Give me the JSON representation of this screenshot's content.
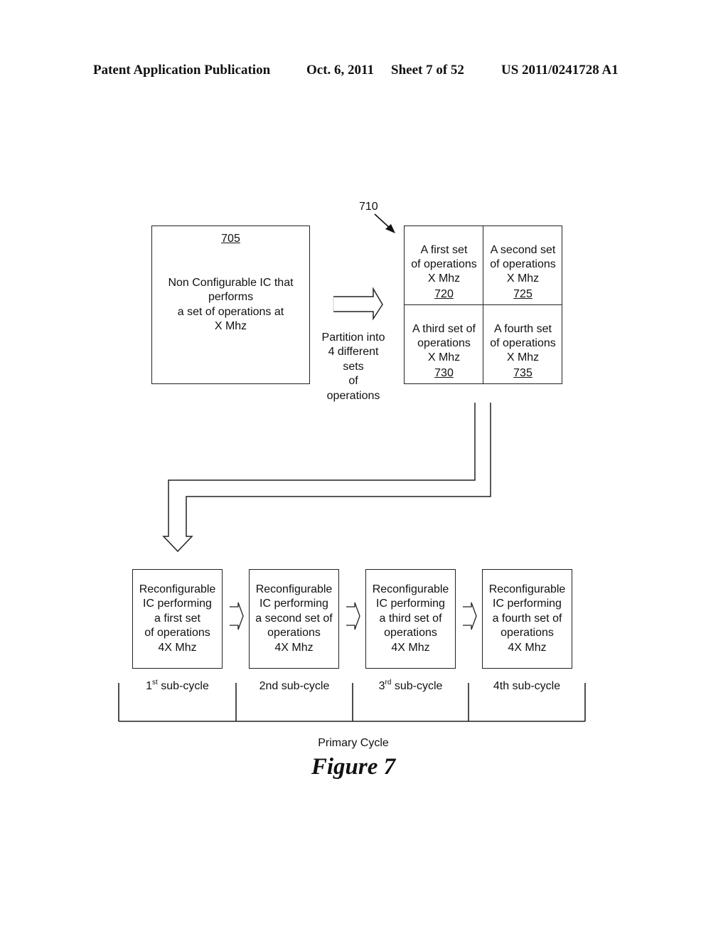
{
  "header": {
    "publication": "Patent Application Publication",
    "date": "Oct. 6, 2011",
    "sheet": "Sheet 7 of 52",
    "number": "US 2011/0241728 A1"
  },
  "block_705": {
    "ref": "705",
    "lines": [
      "Non Configurable IC that",
      "performs",
      "a set of operations at",
      "X Mhz"
    ]
  },
  "partition_arrow": {
    "lines": [
      "Partition into",
      "4 different",
      "sets",
      "of",
      "operations"
    ]
  },
  "block_710": {
    "ref": "710",
    "cells": [
      {
        "lines": [
          "A first set",
          "of operations",
          "X Mhz"
        ],
        "ref": "720"
      },
      {
        "lines": [
          "A second set",
          "of operations",
          "X Mhz"
        ],
        "ref": "725"
      },
      {
        "lines": [
          "A third set of",
          "operations",
          "X Mhz"
        ],
        "ref": "730"
      },
      {
        "lines": [
          "A fourth set",
          "of operations",
          "X Mhz"
        ],
        "ref": "735"
      }
    ]
  },
  "reconfigurable_blocks": [
    {
      "lines": [
        "Reconfigurable",
        "IC performing",
        "a first set",
        "of operations",
        "4X Mhz"
      ]
    },
    {
      "lines": [
        "Reconfigurable",
        "IC performing",
        "a second set of",
        "operations",
        "4X Mhz"
      ]
    },
    {
      "lines": [
        "Reconfigurable",
        "IC performing",
        "a third set of",
        "operations",
        "4X Mhz"
      ]
    },
    {
      "lines": [
        "Reconfigurable",
        "IC performing",
        "a fourth set of",
        "operations",
        "4X Mhz"
      ]
    }
  ],
  "sub_cycles": [
    {
      "prefix": "1",
      "sup": "st",
      "suffix": " sub-cycle"
    },
    {
      "prefix": "2nd",
      "sup": "",
      "suffix": " sub-cycle"
    },
    {
      "prefix": "3",
      "sup": "rd",
      "suffix": " sub-cycle"
    },
    {
      "prefix": "4th",
      "sup": "",
      "suffix": " sub-cycle"
    }
  ],
  "primary_cycle_label": "Primary Cycle",
  "figure_caption": "Figure 7"
}
